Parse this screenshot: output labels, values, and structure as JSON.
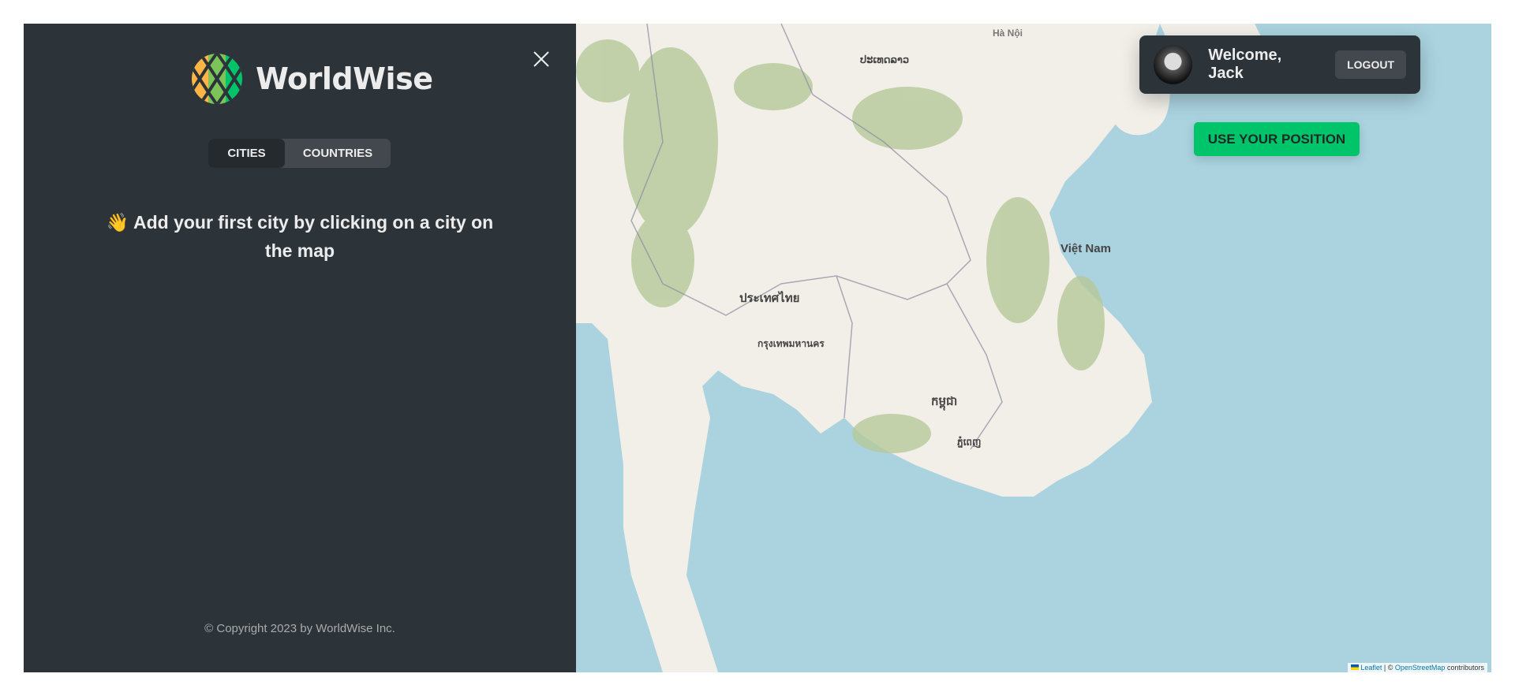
{
  "sidebar": {
    "brand": "WorldWise",
    "tabs": [
      {
        "label": "CITIES",
        "active": true
      },
      {
        "label": "COUNTRIES",
        "active": false
      }
    ],
    "message_emoji": "👋",
    "message": "Add your first city by clicking on a city on the map",
    "copyright": "© Copyright 2023 by WorldWise Inc."
  },
  "user": {
    "welcome": "Welcome, Jack",
    "logout_label": "LOGOUT"
  },
  "map": {
    "zoom_in": "+",
    "zoom_out": "−",
    "use_position_label": "USE YOUR POSITION",
    "labels": [
      "ປະເທດລາວ",
      "ประเทศไทย",
      "Việt Nam",
      "កម្ពុជា",
      "กรุงเทพมหานคร",
      "ភ្នំពេញ",
      "Hà Nội"
    ],
    "attribution": {
      "leaflet": "Leaflet",
      "separator": "| ©",
      "osm": "OpenStreetMap",
      "suffix": "contributors"
    },
    "colors": {
      "water": "#aad3df",
      "land": "#f2efe9",
      "forest": "#b7c99a",
      "accent": "#00c46a"
    }
  }
}
